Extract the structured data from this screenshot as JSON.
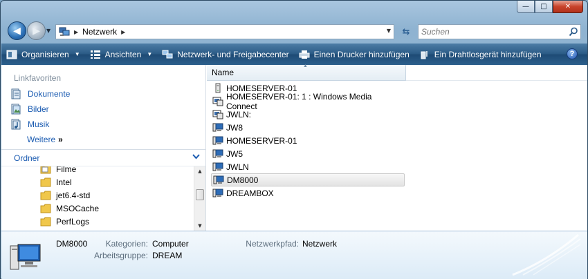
{
  "window": {
    "caption": {
      "minimize": "—",
      "maximize": "□",
      "close": "✕"
    }
  },
  "address": {
    "path": "Netzwerk"
  },
  "search": {
    "placeholder": "Suchen"
  },
  "toolbar": {
    "organize": "Organisieren",
    "views": "Ansichten",
    "network_center": "Netzwerk- und Freigabecenter",
    "add_printer": "Einen Drucker hinzufügen",
    "add_wireless": "Ein Drahtlosgerät hinzufügen",
    "help": "?"
  },
  "nav": {
    "favorites_header": "Linkfavoriten",
    "favorites": [
      {
        "label": "Dokumente",
        "icon": "documents-icon"
      },
      {
        "label": "Bilder",
        "icon": "pictures-icon"
      },
      {
        "label": "Musik",
        "icon": "music-icon"
      }
    ],
    "more": "Weitere",
    "more_glyph": "»",
    "folders_header": "Ordner",
    "folders": [
      "Filme",
      "Intel",
      "jet6.4-std",
      "MSOCache",
      "PerfLogs"
    ]
  },
  "list": {
    "column_name": "Name",
    "items": [
      {
        "label": "HOMESERVER-01",
        "icon": "server-icon",
        "selected": false
      },
      {
        "label": "HOMESERVER-01: 1 : Windows Media Connect",
        "icon": "media-device-icon",
        "selected": false
      },
      {
        "label": "JWLN:",
        "icon": "media-device-icon",
        "selected": false
      },
      {
        "label": "JW8",
        "icon": "computer-icon",
        "selected": false
      },
      {
        "label": "HOMESERVER-01",
        "icon": "computer-icon",
        "selected": false
      },
      {
        "label": "JW5",
        "icon": "computer-icon",
        "selected": false
      },
      {
        "label": "JWLN",
        "icon": "computer-icon",
        "selected": false
      },
      {
        "label": "DM8000",
        "icon": "computer-icon",
        "selected": true
      },
      {
        "label": "DREAMBOX",
        "icon": "computer-icon",
        "selected": false
      }
    ]
  },
  "details": {
    "name": "DM8000",
    "category_label": "Kategorien:",
    "category_value": "Computer",
    "workgroup_label": "Arbeitsgruppe:",
    "workgroup_value": "DREAM",
    "path_label": "Netzwerkpfad:",
    "path_value": "Netzwerk"
  }
}
